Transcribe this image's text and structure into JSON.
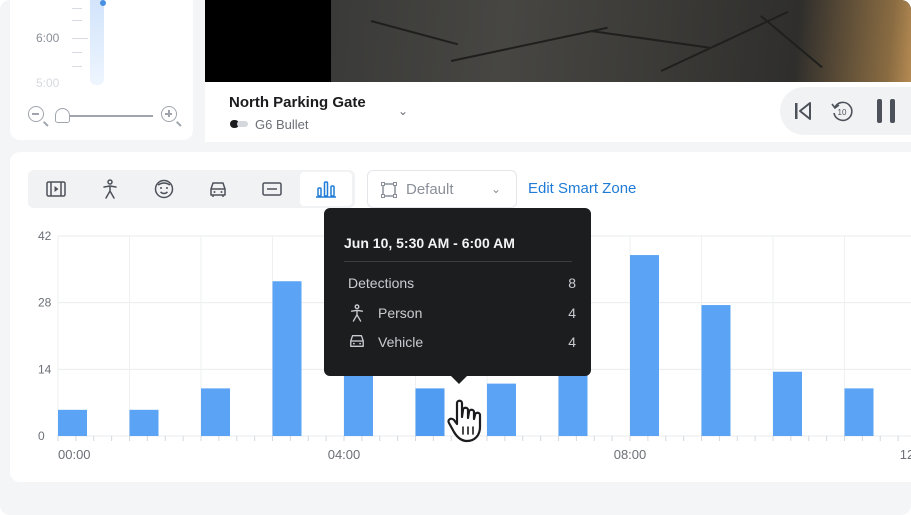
{
  "timeline": {
    "time_label": "6:00",
    "time_label_faint": "5:00"
  },
  "camera": {
    "name": "North Parking Gate",
    "model": "G6 Bullet"
  },
  "playback": {
    "rewind_seconds": "10"
  },
  "filters": {
    "items": [
      {
        "name": "all-events",
        "icon": "film-icon"
      },
      {
        "name": "person",
        "icon": "person-icon"
      },
      {
        "name": "face",
        "icon": "face-icon"
      },
      {
        "name": "vehicle",
        "icon": "car-icon"
      },
      {
        "name": "license-plate",
        "icon": "plate-icon"
      },
      {
        "name": "chart",
        "icon": "bar-chart-icon",
        "active": true
      }
    ]
  },
  "zone": {
    "selected": "Default",
    "edit_link": "Edit Smart Zone"
  },
  "colors": {
    "bar": "#5ba4f5",
    "accent": "#1f7bd6",
    "tooltip_bg": "#1c1d1f"
  },
  "tooltip": {
    "title": "Jun 10, 5:30 AM - 6:00 AM",
    "rows": [
      {
        "label": "Detections",
        "value": "8"
      },
      {
        "label": "Person",
        "value": "4",
        "icon": "person-icon"
      },
      {
        "label": "Vehicle",
        "value": "4",
        "icon": "car-icon"
      }
    ]
  },
  "chart_data": {
    "type": "bar",
    "title": "",
    "xlabel": "",
    "ylabel": "",
    "ylim": [
      0,
      42
    ],
    "yticks": [
      0,
      14,
      28,
      42
    ],
    "xticks": [
      "00:00",
      "04:00",
      "08:00",
      "12:00"
    ],
    "x": [
      0,
      1,
      2,
      3,
      4,
      5,
      6,
      7,
      8,
      9,
      10,
      11,
      12
    ],
    "x_units": "hours",
    "values": [
      5.5,
      5.5,
      10,
      32.5,
      13,
      10,
      11,
      38,
      38,
      27.5,
      13.5,
      10
    ],
    "highlighted_index": 5,
    "grid": true,
    "legend": "none"
  }
}
